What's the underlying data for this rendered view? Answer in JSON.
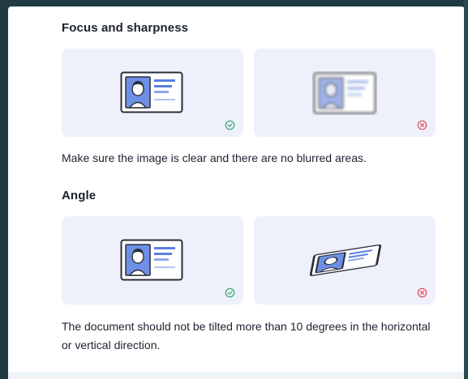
{
  "sections": [
    {
      "title": "Focus and sharpness",
      "good_example": {
        "status": "correct",
        "illustration": "sharp-id-card-icon"
      },
      "bad_example": {
        "status": "incorrect",
        "illustration": "blurred-id-card-icon"
      },
      "description": "Make sure the image is clear and there are no blurred areas."
    },
    {
      "title": "Angle",
      "good_example": {
        "status": "correct",
        "illustration": "straight-id-card-icon"
      },
      "bad_example": {
        "status": "incorrect",
        "illustration": "tilted-id-card-icon"
      },
      "description": "The document should not be tilted more than 10 degrees in the horizontal or vertical direction."
    }
  ],
  "colors": {
    "card_background": "#eef1fb",
    "accent_blue": "#5b7fe0",
    "correct_green": "#2fa86a",
    "incorrect_red": "#e24a5a",
    "text": "#1c2230"
  }
}
